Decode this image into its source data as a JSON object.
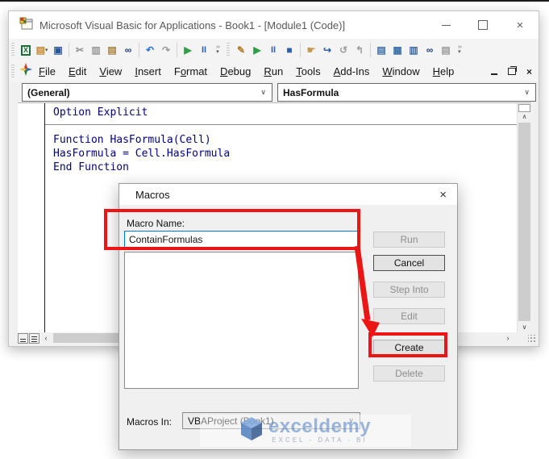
{
  "app": {
    "title": "Microsoft Visual Basic for Applications - Book1 - [Module1 (Code)]"
  },
  "toolbars": {
    "standard": [
      {
        "name": "view-microsoft-excel-icon",
        "glyph": "X",
        "color": "#1c6b38",
        "boxed": true
      },
      {
        "name": "insert-userform-icon",
        "glyph": "▤",
        "color": "#c2882f",
        "dropdown": true
      },
      {
        "name": "save-icon",
        "glyph": "▣",
        "color": "#2b579a"
      },
      {
        "sep": true
      },
      {
        "name": "cut-icon",
        "glyph": "✂",
        "color": "#909090"
      },
      {
        "name": "copy-icon",
        "glyph": "▥",
        "color": "#9b9b9b"
      },
      {
        "name": "paste-icon",
        "glyph": "▤",
        "color": "#a8823c"
      },
      {
        "name": "find-icon",
        "glyph": "∞",
        "color": "#1f3c78"
      },
      {
        "sep": true
      },
      {
        "name": "undo-icon",
        "glyph": "↶",
        "color": "#2a6fd6"
      },
      {
        "name": "redo-icon",
        "glyph": "↷",
        "color": "#9b9b9b"
      },
      {
        "sep": true
      },
      {
        "name": "run-sub-icon",
        "glyph": "▶",
        "color": "#2f9e44"
      },
      {
        "name": "break-icon",
        "glyph": "II",
        "color": "#2f5fa8",
        "pause": true
      },
      {
        "overflow": true,
        "name": "toolbar-options-icon"
      }
    ],
    "debug": [
      {
        "name": "design-mode-icon",
        "glyph": "✎",
        "color": "#b07c2a"
      },
      {
        "name": "run-sub-icon",
        "glyph": "▶",
        "color": "#2f9e44"
      },
      {
        "name": "break-icon",
        "glyph": "II",
        "color": "#2f5fa8",
        "pause": true
      },
      {
        "name": "reset-icon",
        "glyph": "■",
        "color": "#2f5fa8"
      },
      {
        "sep": true
      },
      {
        "name": "toggle-breakpoint-icon",
        "glyph": "☛",
        "color": "#c49a52"
      },
      {
        "name": "step-into-icon",
        "glyph": "↪",
        "color": "#2f5fa8"
      },
      {
        "name": "step-over-icon",
        "glyph": "↺",
        "color": "#9b9b9b"
      },
      {
        "name": "step-out-icon",
        "glyph": "↰",
        "color": "#9b9b9b"
      },
      {
        "sep": true
      },
      {
        "name": "locals-window-icon",
        "glyph": "▤",
        "color": "#3a6ea5"
      },
      {
        "name": "immediate-window-icon",
        "glyph": "▦",
        "color": "#3a6ea5"
      },
      {
        "name": "watch-window-icon",
        "glyph": "▥",
        "color": "#3a6ea5"
      },
      {
        "name": "quick-watch-icon",
        "glyph": "∞",
        "color": "#1f3c78"
      },
      {
        "name": "call-stack-icon",
        "glyph": "▤",
        "color": "#9b9b9b"
      },
      {
        "overflow": true,
        "name": "toolbar-options-icon"
      }
    ]
  },
  "menu": {
    "items": [
      {
        "label": "File",
        "u": 0
      },
      {
        "label": "Edit",
        "u": 0
      },
      {
        "label": "View",
        "u": 0
      },
      {
        "label": "Insert",
        "u": 0
      },
      {
        "label": "Format",
        "u": 1
      },
      {
        "label": "Debug",
        "u": 0
      },
      {
        "label": "Run",
        "u": 0
      },
      {
        "label": "Tools",
        "u": 0
      },
      {
        "label": "Add-Ins",
        "u": 0
      },
      {
        "label": "Window",
        "u": 0
      },
      {
        "label": "Help",
        "u": 0
      }
    ]
  },
  "code_pane": {
    "object_combo": "(General)",
    "procedure_combo": "HasFormula",
    "lines": [
      "Option Explicit",
      "",
      "Function HasFormula(Cell)",
      "HasFormula = Cell.HasFormula",
      "End Function"
    ]
  },
  "dialog": {
    "title": "Macros",
    "macro_name_label": "Macro Name:",
    "macro_name": "ContainFormulas",
    "buttons": [
      {
        "label": "Run",
        "enabled": false
      },
      {
        "label": "Cancel",
        "enabled": true,
        "default": true
      },
      {
        "label": "Step Into",
        "enabled": false
      },
      {
        "label": "Edit",
        "enabled": false
      },
      {
        "label": "Create",
        "enabled": true,
        "highlighted": true
      },
      {
        "label": "Delete",
        "enabled": false
      }
    ],
    "macros_in_label": "Macros In:",
    "macros_in": "VBAProject (Book1)"
  },
  "watermark": {
    "brand": "exceldemy",
    "tagline": "EXCEL - DATA - BI"
  },
  "colors": {
    "code_text": "#00007f",
    "annotation_red": "#ec1515",
    "focus_border": "#0078d7"
  }
}
